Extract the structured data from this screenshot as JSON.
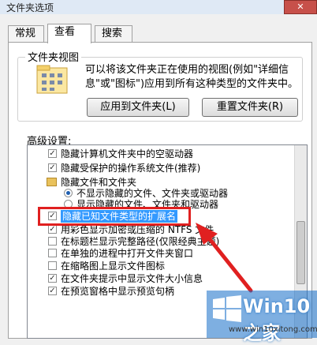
{
  "window": {
    "title": "文件夹选项",
    "close_icon": "close-icon"
  },
  "tabs": [
    {
      "label": "常规",
      "active": false
    },
    {
      "label": "查看",
      "active": true
    },
    {
      "label": "搜索",
      "active": false
    }
  ],
  "folder_views": {
    "label": "文件夹视图",
    "description": "可以将该文件夹正在使用的视图(例如\"详细信息\"或\"图标\")应用到所有这种类型的文件夹中。",
    "apply_button": "应用到文件夹(L)",
    "reset_button": "重置文件夹(R)"
  },
  "advanced": {
    "label": "高级设置:",
    "items": [
      {
        "type": "checkbox",
        "checked": true,
        "label": "隐藏计算机文件夹中的空驱动器"
      },
      {
        "type": "checkbox",
        "checked": true,
        "label": "隐藏受保护的操作系统文件(推荐)"
      },
      {
        "type": "folder",
        "label": "隐藏文件和文件夹"
      },
      {
        "type": "radio",
        "checked": true,
        "label": "不显示隐藏的文件、文件夹或驱动器"
      },
      {
        "type": "radio",
        "checked": false,
        "label": "显示隐藏的文件、文件夹和驱动器"
      },
      {
        "type": "checkbox",
        "checked": true,
        "label": "隐藏已知文件类型的扩展名",
        "highlighted": true
      },
      {
        "type": "checkbox",
        "checked": true,
        "label": "用彩色显示加密或压缩的 NTFS 文件"
      },
      {
        "type": "checkbox",
        "checked": false,
        "label": "在标题栏显示完整路径(仅限经典主题)"
      },
      {
        "type": "checkbox",
        "checked": false,
        "label": "在单独的进程中打开文件夹窗口"
      },
      {
        "type": "checkbox",
        "checked": false,
        "label": "在缩略图上显示文件图标"
      },
      {
        "type": "checkbox",
        "checked": true,
        "label": "在文件夹提示中显示文件大小信息"
      },
      {
        "type": "checkbox",
        "checked": true,
        "label": "在预览窗格中显示预览句柄"
      }
    ]
  },
  "watermark": {
    "brand": "Win10 之家",
    "url": "www.win10xitong.com"
  },
  "colors": {
    "highlight": "#3399ff",
    "annotation": "#e02020"
  }
}
